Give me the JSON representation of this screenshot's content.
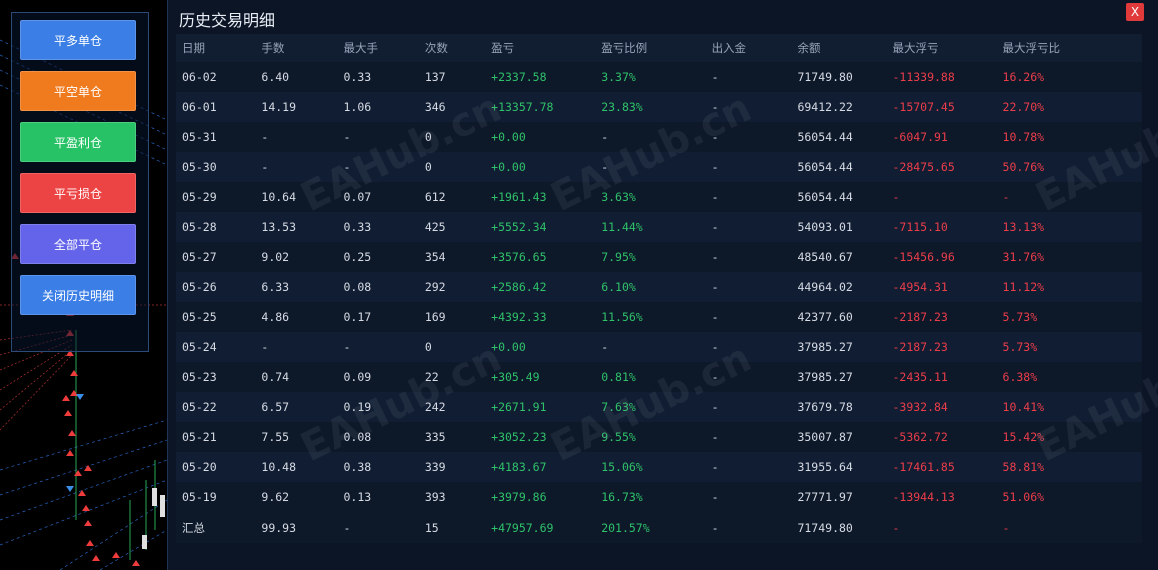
{
  "colors": {
    "profit_text": "#2fc26a",
    "loss_text": "#ec3d4b"
  },
  "side_buttons": [
    {
      "label": "平多单仓",
      "color": "#3a7ee6",
      "icon": "none"
    },
    {
      "label": "平空单仓",
      "color": "#f07a1e",
      "icon": "none"
    },
    {
      "label": "平盈利仓",
      "color": "#27c265",
      "icon": "none"
    },
    {
      "label": "平亏损仓",
      "color": "#ec4444",
      "icon": "none"
    },
    {
      "label": "全部平仓",
      "color": "#6464ea",
      "icon": "none"
    },
    {
      "label": "关闭历史明细",
      "color": "#3a7ee6",
      "icon": "none"
    }
  ],
  "panel": {
    "title": "历史交易明细",
    "close_label": "X",
    "headers": [
      "日期",
      "手数",
      "最大手",
      "次数",
      "盈亏",
      "盈亏比例",
      "出入金",
      "余额",
      "最大浮亏",
      "最大浮亏比"
    ],
    "rows": [
      [
        "06-02",
        "6.40",
        "0.33",
        "137",
        "+2337.58",
        "3.37%",
        "-",
        "71749.80",
        "-11339.88",
        "16.26%"
      ],
      [
        "06-01",
        "14.19",
        "1.06",
        "346",
        "+13357.78",
        "23.83%",
        "-",
        "69412.22",
        "-15707.45",
        "22.70%"
      ],
      [
        "05-31",
        "-",
        "-",
        "0",
        "+0.00",
        "-",
        "-",
        "56054.44",
        "-6047.91",
        "10.78%"
      ],
      [
        "05-30",
        "-",
        "-",
        "0",
        "+0.00",
        "-",
        "-",
        "56054.44",
        "-28475.65",
        "50.76%"
      ],
      [
        "05-29",
        "10.64",
        "0.07",
        "612",
        "+1961.43",
        "3.63%",
        "-",
        "56054.44",
        "-",
        "-"
      ],
      [
        "05-28",
        "13.53",
        "0.33",
        "425",
        "+5552.34",
        "11.44%",
        "-",
        "54093.01",
        "-7115.10",
        "13.13%"
      ],
      [
        "05-27",
        "9.02",
        "0.25",
        "354",
        "+3576.65",
        "7.95%",
        "-",
        "48540.67",
        "-15456.96",
        "31.76%"
      ],
      [
        "05-26",
        "6.33",
        "0.08",
        "292",
        "+2586.42",
        "6.10%",
        "-",
        "44964.02",
        "-4954.31",
        "11.12%"
      ],
      [
        "05-25",
        "4.86",
        "0.17",
        "169",
        "+4392.33",
        "11.56%",
        "-",
        "42377.60",
        "-2187.23",
        "5.73%"
      ],
      [
        "05-24",
        "-",
        "-",
        "0",
        "+0.00",
        "-",
        "-",
        "37985.27",
        "-2187.23",
        "5.73%"
      ],
      [
        "05-23",
        "0.74",
        "0.09",
        "22",
        "+305.49",
        "0.81%",
        "-",
        "37985.27",
        "-2435.11",
        "6.38%"
      ],
      [
        "05-22",
        "6.57",
        "0.19",
        "242",
        "+2671.91",
        "7.63%",
        "-",
        "37679.78",
        "-3932.84",
        "10.41%"
      ],
      [
        "05-21",
        "7.55",
        "0.08",
        "335",
        "+3052.23",
        "9.55%",
        "-",
        "35007.87",
        "-5362.72",
        "15.42%"
      ],
      [
        "05-20",
        "10.48",
        "0.38",
        "339",
        "+4183.67",
        "15.06%",
        "-",
        "31955.64",
        "-17461.85",
        "58.81%"
      ],
      [
        "05-19",
        "9.62",
        "0.13",
        "393",
        "+3979.86",
        "16.73%",
        "-",
        "27771.97",
        "-13944.13",
        "51.06%"
      ]
    ],
    "summary": [
      "汇总",
      "99.93",
      "-",
      "15",
      "+47957.69",
      "201.57%",
      "-",
      "71749.80",
      "-",
      "-"
    ]
  },
  "watermark": "EAHub.cn"
}
